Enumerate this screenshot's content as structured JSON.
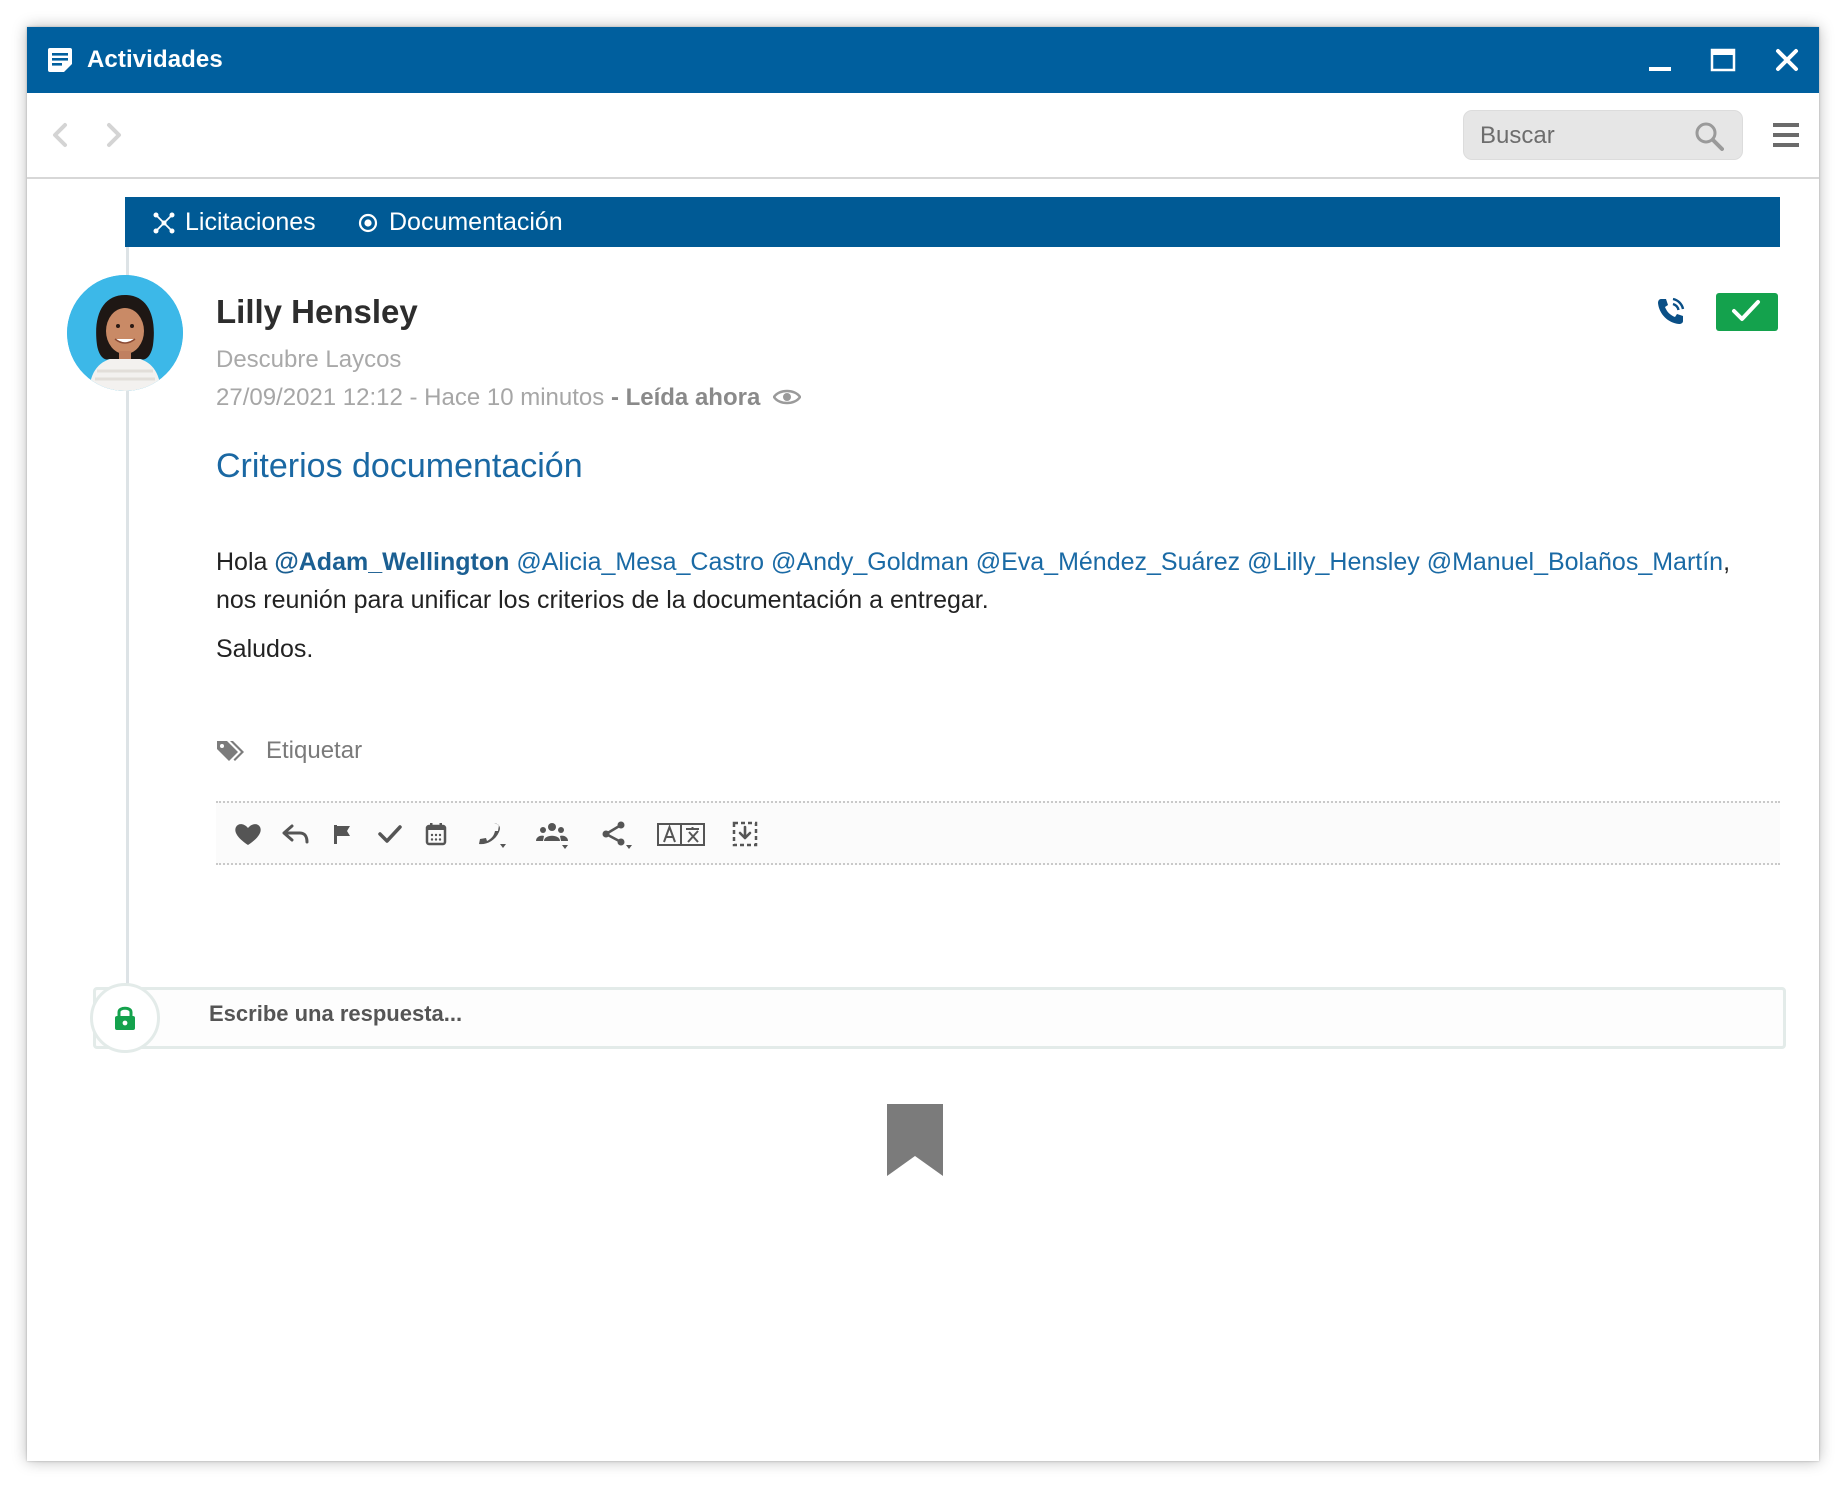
{
  "window": {
    "title": "Actividades",
    "controls": {
      "minimize": "minimize",
      "maximize": "maximize",
      "close": "close"
    }
  },
  "toolbar": {
    "search_placeholder": "Buscar"
  },
  "breadcrumb": [
    {
      "label": "Licitaciones",
      "icon": "network-icon"
    },
    {
      "label": "Documentación",
      "icon": "target-icon"
    }
  ],
  "activity": {
    "author": "Lilly Hensley",
    "subtitle": "Descubre Laycos",
    "timestamp": "27/09/2021 12:12 - Hace 10 minutos",
    "read_status": "- Leída ahora",
    "subject": "Criterios documentación",
    "body": {
      "greeting": "Hola",
      "mentions": [
        "@Adam_Wellington",
        "@Alicia_Mesa_Castro",
        "@Andy_Goldman",
        "@Eva_Méndez_Suárez",
        "@Lilly_Hensley",
        "@Manuel_Bolaños_Martín"
      ],
      "sentence_rest": ", nos reunión para unificar los criterios de la documentación a entregar.",
      "closing": "Saludos."
    },
    "tag_label": "Etiquetar",
    "status_color": "#14a24d"
  },
  "actions": [
    "heart-icon",
    "reply-icon",
    "flag-icon",
    "check-icon",
    "calendar-icon",
    "phone-icon",
    "group-icon",
    "share-icon",
    "translate-icon",
    "download-box-icon"
  ],
  "reply": {
    "placeholder": "Escribe una respuesta..."
  },
  "colors": {
    "titlebar": "#005f9e",
    "breadcrumb": "#005a95",
    "link": "#1a68a3",
    "success": "#14a24d"
  }
}
